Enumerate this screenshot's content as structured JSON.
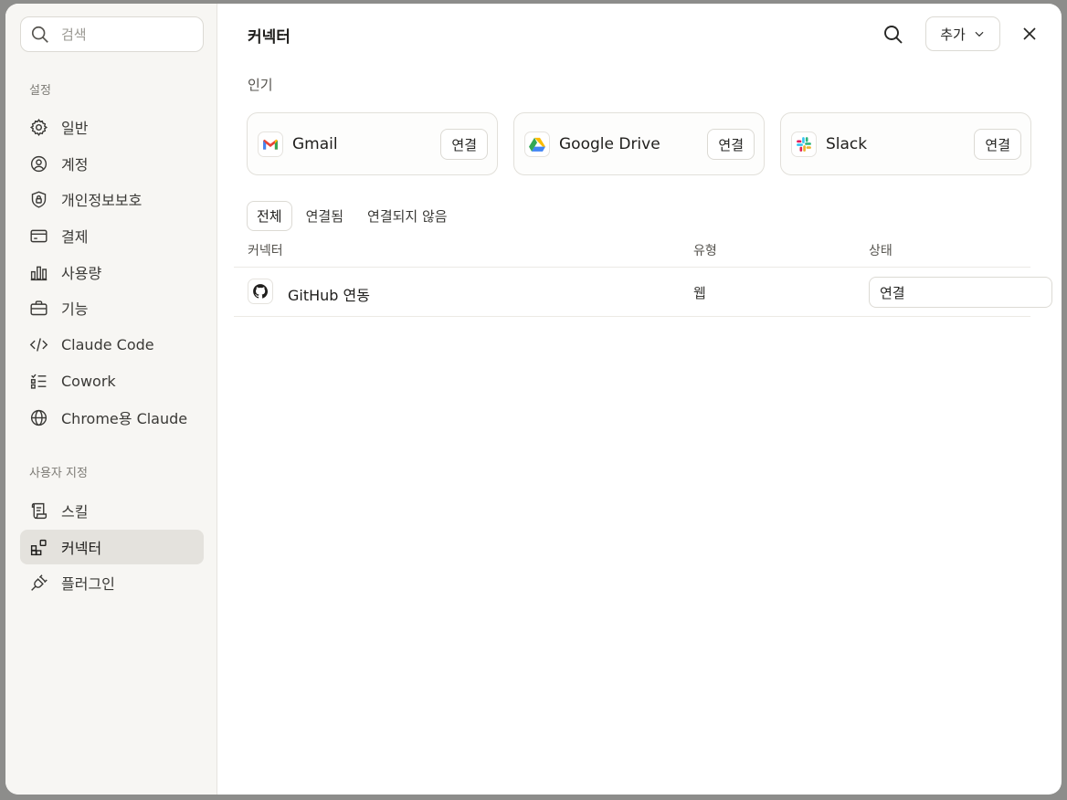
{
  "sidebar": {
    "search_placeholder": "검색",
    "section_settings": "설정",
    "settings_items": [
      {
        "label": "일반",
        "icon": "gear-icon"
      },
      {
        "label": "계정",
        "icon": "user-circle-icon"
      },
      {
        "label": "개인정보보호",
        "icon": "shield-lock-icon"
      },
      {
        "label": "결제",
        "icon": "credit-card-icon"
      },
      {
        "label": "사용량",
        "icon": "bar-chart-icon"
      },
      {
        "label": "기능",
        "icon": "briefcase-icon"
      },
      {
        "label": "Claude Code",
        "icon": "code-icon"
      },
      {
        "label": "Cowork",
        "icon": "checklist-icon"
      },
      {
        "label": "Chrome용 Claude",
        "icon": "globe-icon"
      }
    ],
    "section_custom": "사용자 지정",
    "custom_items": [
      {
        "label": "스킬",
        "icon": "scroll-icon"
      },
      {
        "label": "커넥터",
        "icon": "connector-icon",
        "active": true
      },
      {
        "label": "플러그인",
        "icon": "plug-icon"
      }
    ]
  },
  "header": {
    "title": "커넥터",
    "add_label": "추가"
  },
  "popular": {
    "label": "인기",
    "cards": [
      {
        "name": "Gmail",
        "icon": "gmail-icon",
        "button": "연결"
      },
      {
        "name": "Google Drive",
        "icon": "google-drive-icon",
        "button": "연결"
      },
      {
        "name": "Slack",
        "icon": "slack-icon",
        "button": "연결"
      }
    ]
  },
  "tabs": [
    "전체",
    "연결됨",
    "연결되지 않음"
  ],
  "active_tab": "전체",
  "table": {
    "columns": [
      "커넥터",
      "유형",
      "상태"
    ],
    "rows": [
      {
        "name": "GitHub 연동",
        "icon": "github-icon",
        "type": "웹",
        "status_button": "연결"
      }
    ]
  },
  "colors": {
    "sidebar_bg": "#f7f6f3",
    "active_item_bg": "#e4e2dd",
    "border": "#dcdad4",
    "backdrop": "#8d8d8b"
  }
}
